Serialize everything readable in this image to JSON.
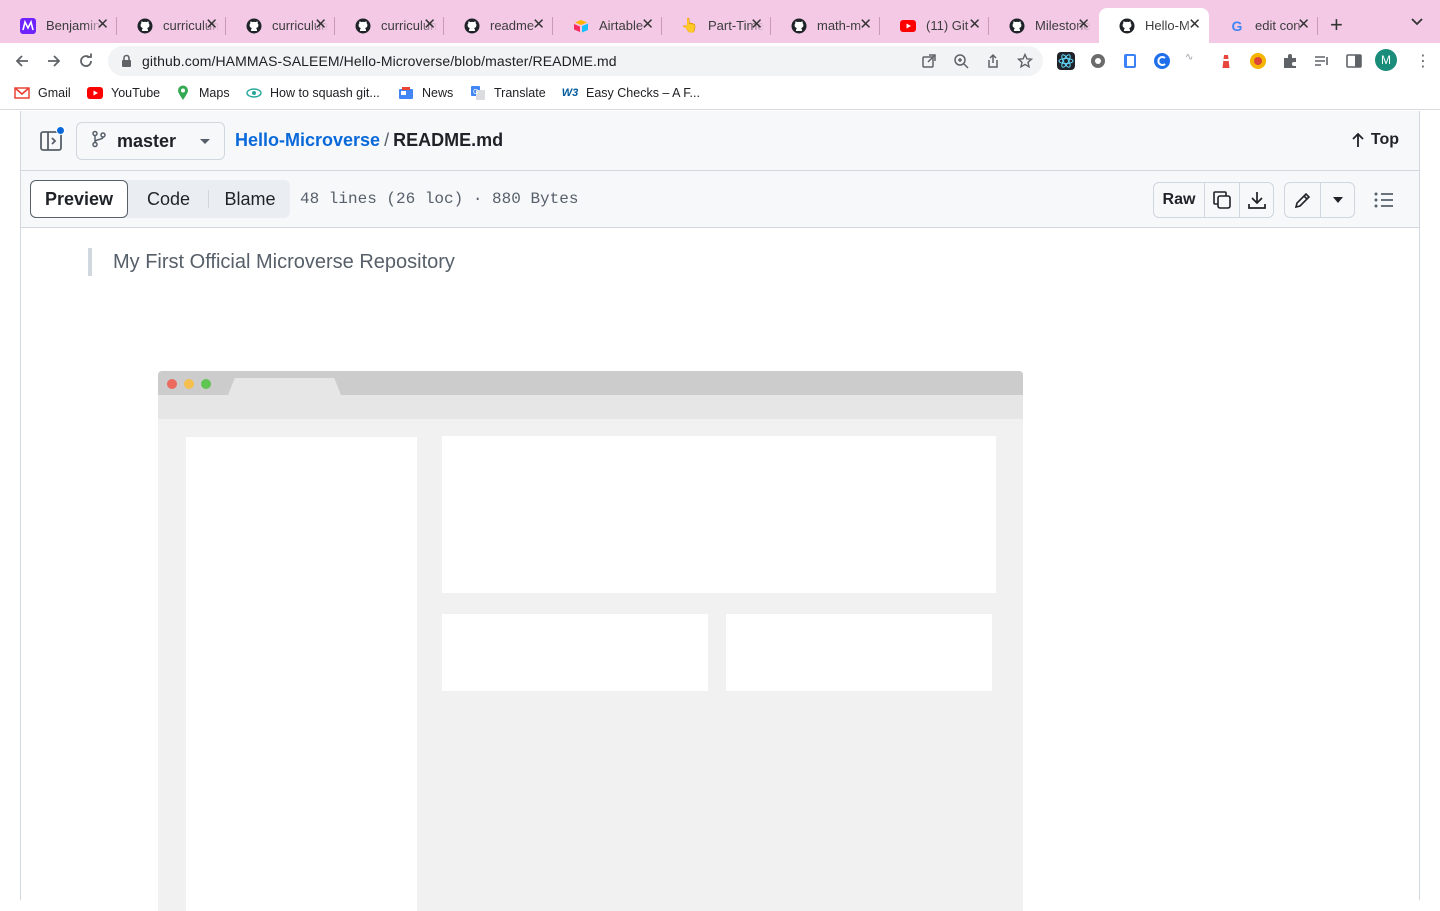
{
  "browser": {
    "tabs": [
      {
        "title": "Benjamin",
        "icon": "microverse-icon"
      },
      {
        "title": "curriculum",
        "icon": "github-icon"
      },
      {
        "title": "curriculum",
        "icon": "github-icon"
      },
      {
        "title": "curriculum",
        "icon": "github-icon"
      },
      {
        "title": "readme",
        "icon": "github-icon"
      },
      {
        "title": "Airtable",
        "icon": "airtable-icon"
      },
      {
        "title": "Part-Time",
        "icon": "hand-icon"
      },
      {
        "title": "math-m",
        "icon": "github-icon"
      },
      {
        "title": "(11) Git",
        "icon": "youtube-icon"
      },
      {
        "title": "Milestone",
        "icon": "github-icon"
      },
      {
        "title": "Hello-M",
        "icon": "github-icon",
        "active": true
      },
      {
        "title": "edit con",
        "icon": "google-icon"
      }
    ],
    "url": "github.com/HAMMAS-SALEEM/Hello-Microverse/blob/master/README.md",
    "profile_initial": "M",
    "bookmarks": [
      {
        "label": "Gmail",
        "icon": "gmail-icon"
      },
      {
        "label": "YouTube",
        "icon": "youtube-icon"
      },
      {
        "label": "Maps",
        "icon": "maps-icon"
      },
      {
        "label": "How to squash git...",
        "icon": "eye-icon"
      },
      {
        "label": "News",
        "icon": "news-icon"
      },
      {
        "label": "Translate",
        "icon": "translate-icon"
      },
      {
        "label": "Easy Checks – A F...",
        "icon": "w3-icon"
      }
    ]
  },
  "file_header": {
    "branch": "master",
    "repo": "Hello-Microverse",
    "separator": "/",
    "file": "README.md",
    "top_label": "Top"
  },
  "file_toolbar": {
    "tabs": [
      "Preview",
      "Code",
      "Blame"
    ],
    "active_tab": "Preview",
    "meta": "48 lines (26 loc) · 880 Bytes",
    "raw_label": "Raw"
  },
  "readme": {
    "blockquote": "My First Official Microverse Repository"
  },
  "colors": {
    "tabbar_bg": "#f3c9e6",
    "link_blue": "#0969da",
    "traffic_red": "#ec6b5e",
    "traffic_yellow": "#f4bf4f",
    "traffic_green": "#61c554"
  }
}
